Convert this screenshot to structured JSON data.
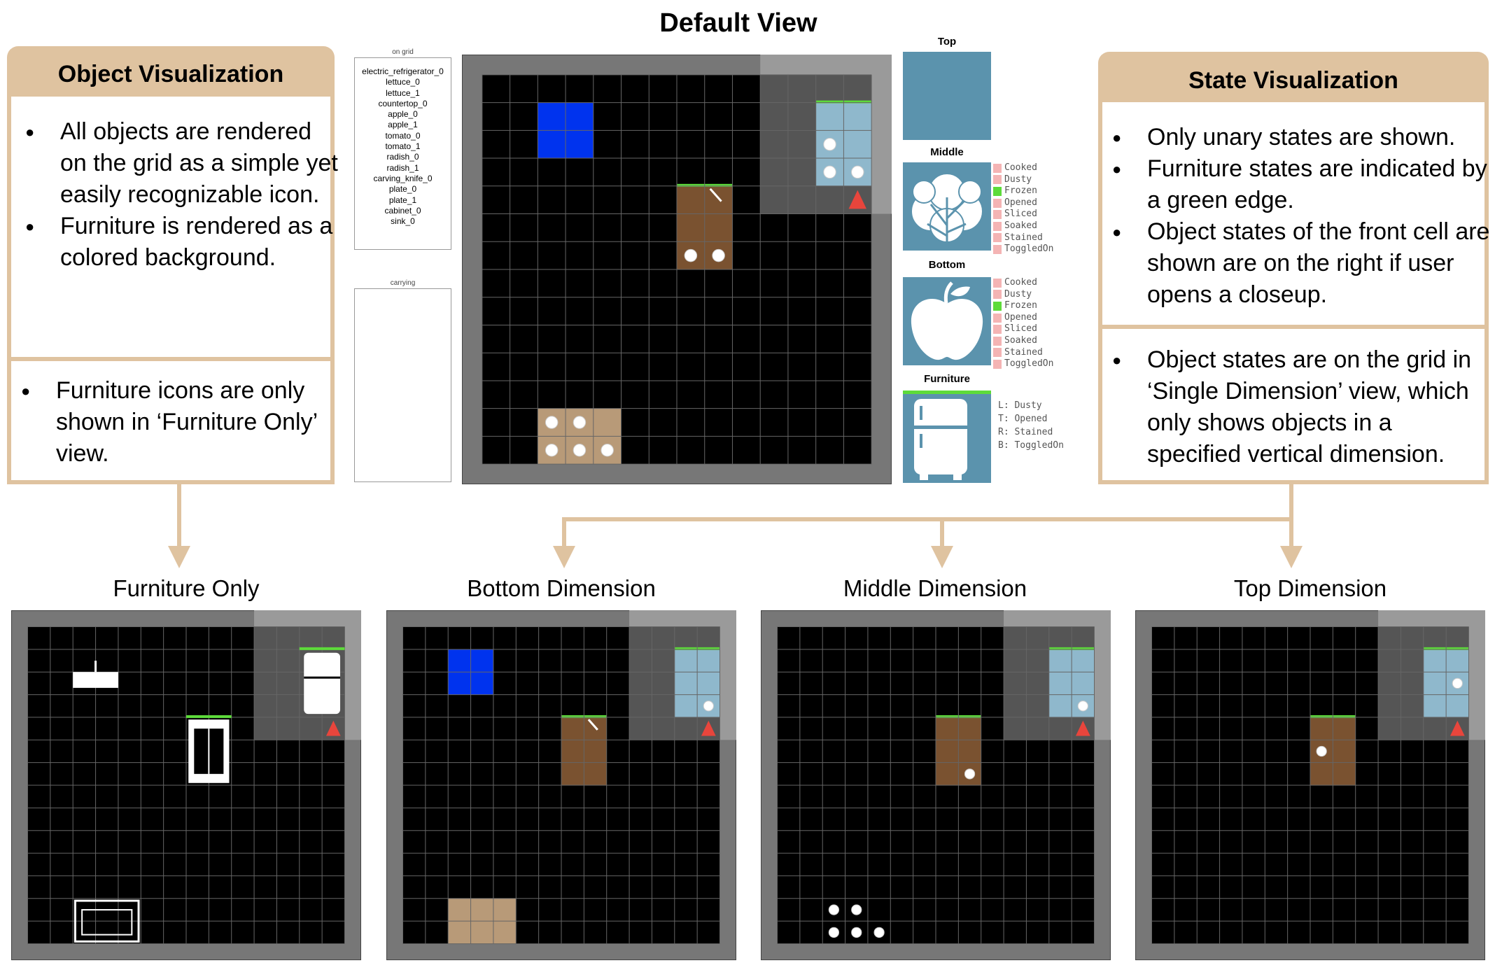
{
  "main_title": "Default View",
  "object_panel": {
    "title": "Object Visualization",
    "bullets": [
      "All objects are rendered on the grid as a simple yet easily recognizable icon.",
      "Furniture is rendered as a colored background."
    ],
    "bullets2": [
      "Furniture icons are only shown in ‘Furniture Only’ view."
    ]
  },
  "state_panel": {
    "title": "State Visualization",
    "bullets": [
      "Only unary states are shown.",
      "Furniture states are indicated by a green edge.",
      "Object states of the front cell are shown are on the right if user opens a closeup."
    ],
    "bullets2": [
      "Object states are on the grid in ‘Single Dimension’ view, which only shows objects in a specified vertical dimension."
    ]
  },
  "on_grid": {
    "caption": "on grid",
    "items": [
      "electric_refrigerator_0",
      "lettuce_0",
      "lettuce_1",
      "countertop_0",
      "apple_0",
      "apple_1",
      "tomato_0",
      "tomato_1",
      "radish_0",
      "radish_1",
      "carving_knife_0",
      "plate_0",
      "plate_1",
      "cabinet_0",
      "sink_0"
    ]
  },
  "carrying": {
    "caption": "carrying"
  },
  "closeup": {
    "top_label": "Top",
    "middle_label": "Middle",
    "bottom_label": "Bottom",
    "furniture_label": "Furniture",
    "middle_states": [
      "Cooked",
      "Dusty",
      "Frozen",
      "Opened",
      "Sliced",
      "Soaked",
      "Stained",
      "ToggledOn"
    ],
    "middle_active": [
      2
    ],
    "bottom_states": [
      "Cooked",
      "Dusty",
      "Frozen",
      "Opened",
      "Sliced",
      "Soaked",
      "Stained",
      "ToggledOn"
    ],
    "bottom_active": [
      2
    ],
    "furniture_states": [
      "L: Dusty",
      "T: Opened",
      "R: Stained",
      "B: ToggledOn"
    ]
  },
  "views": {
    "furniture_only": "Furniture Only",
    "bottom": "Bottom Dimension",
    "middle": "Middle Dimension",
    "top": "Top Dimension"
  },
  "colors": {
    "accent": "#dfc3a0",
    "green_edge": "#5ddb3a",
    "fridge_blue": "#8fb8cc",
    "cabinet_brown": "#7a5230",
    "countertop_tan": "#b89a78",
    "sink_blue": "#0033ee",
    "closeup_blue": "#5b93ad",
    "agent_red": "#e8453c"
  }
}
